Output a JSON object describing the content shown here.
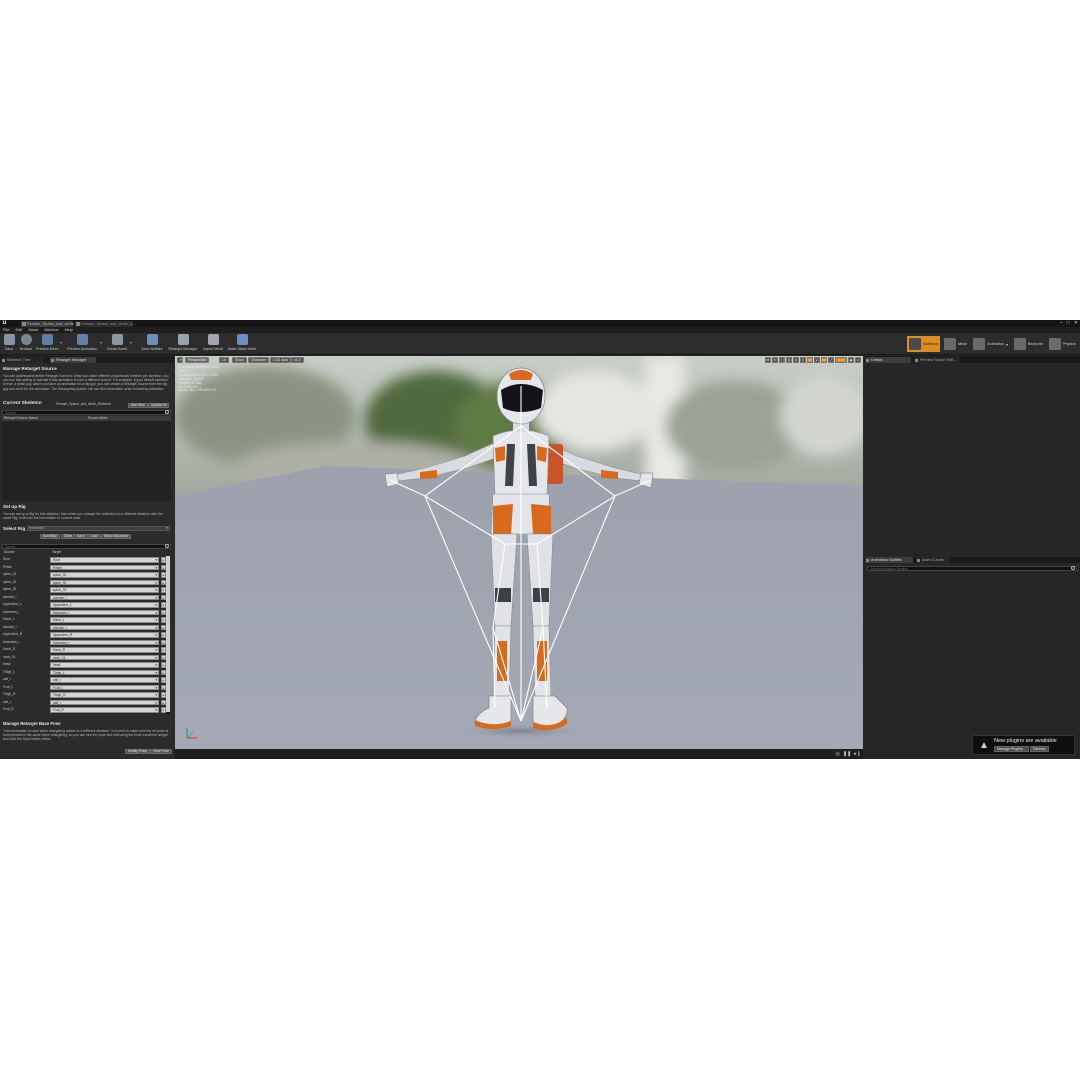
{
  "titlebar": {
    "tabs": [
      {
        "label": "Female_Space_suit_white"
      },
      {
        "label": "Female_Space_suit_white_A..."
      }
    ]
  },
  "menu": [
    "File",
    "Edit",
    "Asset",
    "Window",
    "Help"
  ],
  "toolbar": {
    "buttons": [
      {
        "label": "Save",
        "icon": "save-icon"
      },
      {
        "label": "Browse",
        "icon": "browse-icon"
      },
      {
        "label": "Preview Mesh",
        "icon": "preview-mesh-icon"
      },
      {
        "label": "Preview Animation",
        "icon": "preview-animation-icon"
      },
      {
        "label": "Create Asset",
        "icon": "create-asset-icon"
      },
      {
        "label": "Anim Notifies",
        "icon": "anim-notifies-icon"
      },
      {
        "label": "Retarget Manager",
        "icon": "retarget-manager-icon"
      },
      {
        "label": "Import Mesh",
        "icon": "import-mesh-icon"
      },
      {
        "label": "Make Static Mesh",
        "icon": "make-static-mesh-icon"
      }
    ],
    "modes": [
      {
        "label": "Skeleton",
        "active": true
      },
      {
        "label": "Mesh",
        "active": false
      },
      {
        "label": "Animation",
        "active": false
      },
      {
        "label": "Blueprint",
        "active": false
      },
      {
        "label": "Physics",
        "active": false
      }
    ]
  },
  "left_panel": {
    "tabs": [
      "Skeleton Tree",
      "Retarget Manager"
    ],
    "manage_sources": {
      "title": "Manage Retarget Source",
      "description": "You can add/rename/delete Retarget Sources. When you have different proportional meshes per skeleton, you can use this setting to indicate if this animation is from a different source. For example, if your default skeleton is from a small guy, and if you have an animation for a big guy, you can create a Retarget Source from the big guy and set it for the animation. The Retargeting system will use this information when extracting animation.",
      "search_placeholder": "Search",
      "columns": [
        "Retarget Source Name",
        "Source Mesh"
      ]
    },
    "current_skeleton": {
      "label": "Current Skeleton",
      "name": "Female_Space_suit_white_Skeleton",
      "add_new": "Add New",
      "update_all": "Update All"
    },
    "setup_rig": {
      "title": "Set up Rig",
      "description": "You can set up a Rig for this skeleton, then when you retarget the animation to a different skeleton with the same Rig, it will use the information to convert data.",
      "select_rig_label": "Select Rig",
      "select_rig_value": "Humanoid",
      "buttons": [
        "AutoMap",
        "Clear",
        "Save",
        "Load",
        "Show Advanced"
      ],
      "search_placeholder": "Search",
      "col_source": "Source",
      "col_target": "Target",
      "rows": [
        {
          "source": "Root",
          "target": "Root"
        },
        {
          "source": "Pelvis",
          "target": "Pelvis"
        },
        {
          "source": "spine_01",
          "target": "spine_01"
        },
        {
          "source": "spine_02",
          "target": "spine_02"
        },
        {
          "source": "spine_03",
          "target": "spine_03"
        },
        {
          "source": "clavicle_l",
          "target": "clavicle_l"
        },
        {
          "source": "UpperArm_L",
          "target": "UpperArm_L"
        },
        {
          "source": "lowerarm_l",
          "target": "lowerarm_l"
        },
        {
          "source": "Hand_L",
          "target": "Hand_L"
        },
        {
          "source": "clavicle_r",
          "target": "clavicle_r"
        },
        {
          "source": "UpperArm_R",
          "target": "UpperArm_R"
        },
        {
          "source": "lowerarm_r",
          "target": "lowerarm_r"
        },
        {
          "source": "Hand_R",
          "target": "Hand_R"
        },
        {
          "source": "neck_01",
          "target": "neck_01"
        },
        {
          "source": "head",
          "target": "head"
        },
        {
          "source": "Thigh_L",
          "target": "Thigh_L"
        },
        {
          "source": "calf_l",
          "target": "calf_l"
        },
        {
          "source": "Foot_L",
          "target": "Foot_L"
        },
        {
          "source": "Thigh_R",
          "target": "Thigh_R"
        },
        {
          "source": "calf_r",
          "target": "calf_r"
        },
        {
          "source": "Foot_R",
          "target": "Foot_R"
        }
      ]
    },
    "base_pose": {
      "title": "Manage Retarget Base Pose",
      "description": "This information is used when retargeting assets to a different skeleton. You need to make sure the ref pose of both meshes is the same when retargeting, so you can see the pose and edit using the bone transform widget, and click the Save button below.",
      "modify_pose": "Modify Pose",
      "view_pose": "View Pose"
    }
  },
  "viewport": {
    "chips": [
      "Perspective",
      "Lit",
      "Show",
      "Character",
      "LOD Auto",
      "x1.0"
    ],
    "right_icons": [
      "10",
      "10°",
      "0.25",
      "4"
    ],
    "info": [
      "Previewing Reference Pose",
      "LOD: 0",
      "Current Screen Size: 1.309",
      "Triangles: 16,828",
      "Vertices: 12,581",
      "UV Channels: 1",
      "Approx Size: 154x60x175"
    ]
  },
  "right_panel": {
    "top_tabs": [
      "Details",
      "Preview Scene Sett..."
    ],
    "bottom_tabs": [
      "Animation Notifies",
      "Anim Curves"
    ],
    "search_placeholder": "Search Animation Notifies"
  },
  "toast": {
    "message": "New plugins are available",
    "manage": "Manage Plugins...",
    "dismiss": "Dismiss"
  }
}
